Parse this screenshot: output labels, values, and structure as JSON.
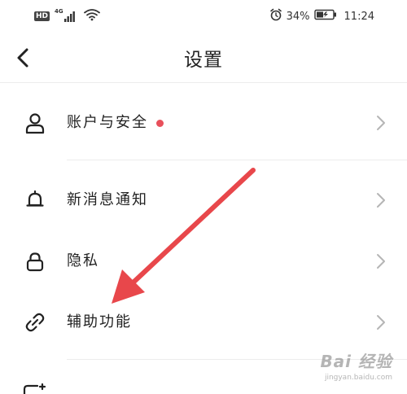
{
  "status_bar": {
    "hd_badge": "HD",
    "network_type": "4G",
    "battery_percent": "34%",
    "time": "11:24",
    "icons": [
      "hd-icon",
      "signal-icon",
      "wifi-icon",
      "alarm-icon",
      "battery-icon"
    ]
  },
  "header": {
    "title": "设置",
    "back_icon": "back-arrow-icon"
  },
  "settings": {
    "items": [
      {
        "label": "账户与安全",
        "icon": "user-icon",
        "has_badge": true
      },
      {
        "label": "新消息通知",
        "icon": "bell-icon",
        "has_badge": false
      },
      {
        "label": "隐私",
        "icon": "lock-icon",
        "has_badge": false
      },
      {
        "label": "辅助功能",
        "icon": "link-icon",
        "has_badge": false
      }
    ]
  },
  "colors": {
    "badge_red": "#e8505b",
    "annotation_arrow": "#e8474b",
    "text_primary": "#222222",
    "chevron": "#b5b5b5",
    "divider": "#ececec"
  },
  "watermark": {
    "main": "Bai 经验",
    "url": "jingyan.baidu.com"
  }
}
